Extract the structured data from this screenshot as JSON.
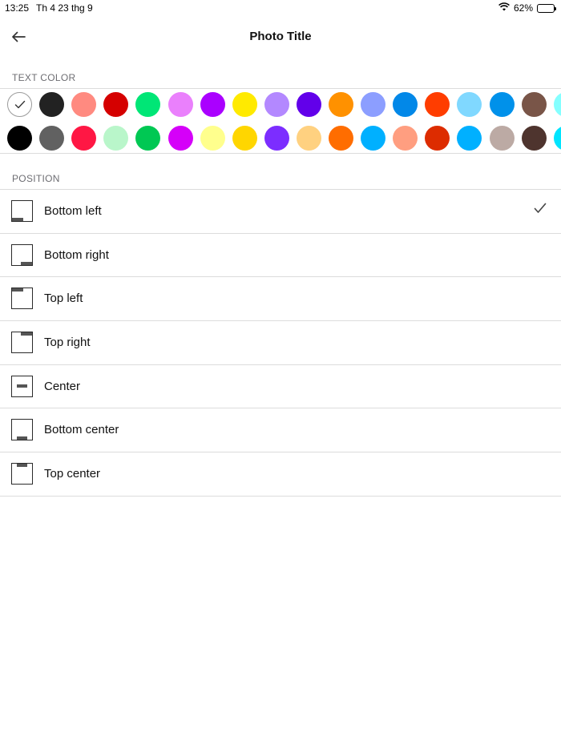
{
  "status_bar": {
    "time": "13:25",
    "date": "Th 4 23 thg 9",
    "battery_text": "62%",
    "battery_level": 0.62
  },
  "nav": {
    "title": "Photo Title",
    "back_icon": "arrow-left-icon"
  },
  "text_color": {
    "header": "TEXT COLOR",
    "selected_index": 0,
    "rows": [
      [
        "#ffffff",
        "#222222",
        "#ff8a80",
        "#d50000",
        "#00e676",
        "#ea80fc",
        "#aa00ff",
        "#ffea00",
        "#b388ff",
        "#6200ea",
        "#ff9100",
        "#8c9eff",
        "#0288e8",
        "#ff3d00",
        "#80d8ff",
        "#0091ea",
        "#795548",
        "#84ffff"
      ],
      [
        "#000000",
        "#616161",
        "#ff1744",
        "#b9f6ca",
        "#00c853",
        "#d500f9",
        "#ffff8d",
        "#ffd600",
        "#7c2dff",
        "#ffd180",
        "#ff6d00",
        "#00b0ff",
        "#ff9e80",
        "#dd2c00",
        "#00b0ff",
        "#bcaaa4",
        "#4e342e",
        "#00e5ff"
      ]
    ]
  },
  "position": {
    "header": "POSITION",
    "selected_index": 0,
    "items": [
      {
        "label": "Bottom left",
        "anchor": "bottom-left"
      },
      {
        "label": "Bottom right",
        "anchor": "bottom-right"
      },
      {
        "label": "Top left",
        "anchor": "top-left"
      },
      {
        "label": "Top right",
        "anchor": "top-right"
      },
      {
        "label": "Center",
        "anchor": "center"
      },
      {
        "label": "Bottom center",
        "anchor": "bottom-center"
      },
      {
        "label": "Top center",
        "anchor": "top-center"
      }
    ]
  }
}
